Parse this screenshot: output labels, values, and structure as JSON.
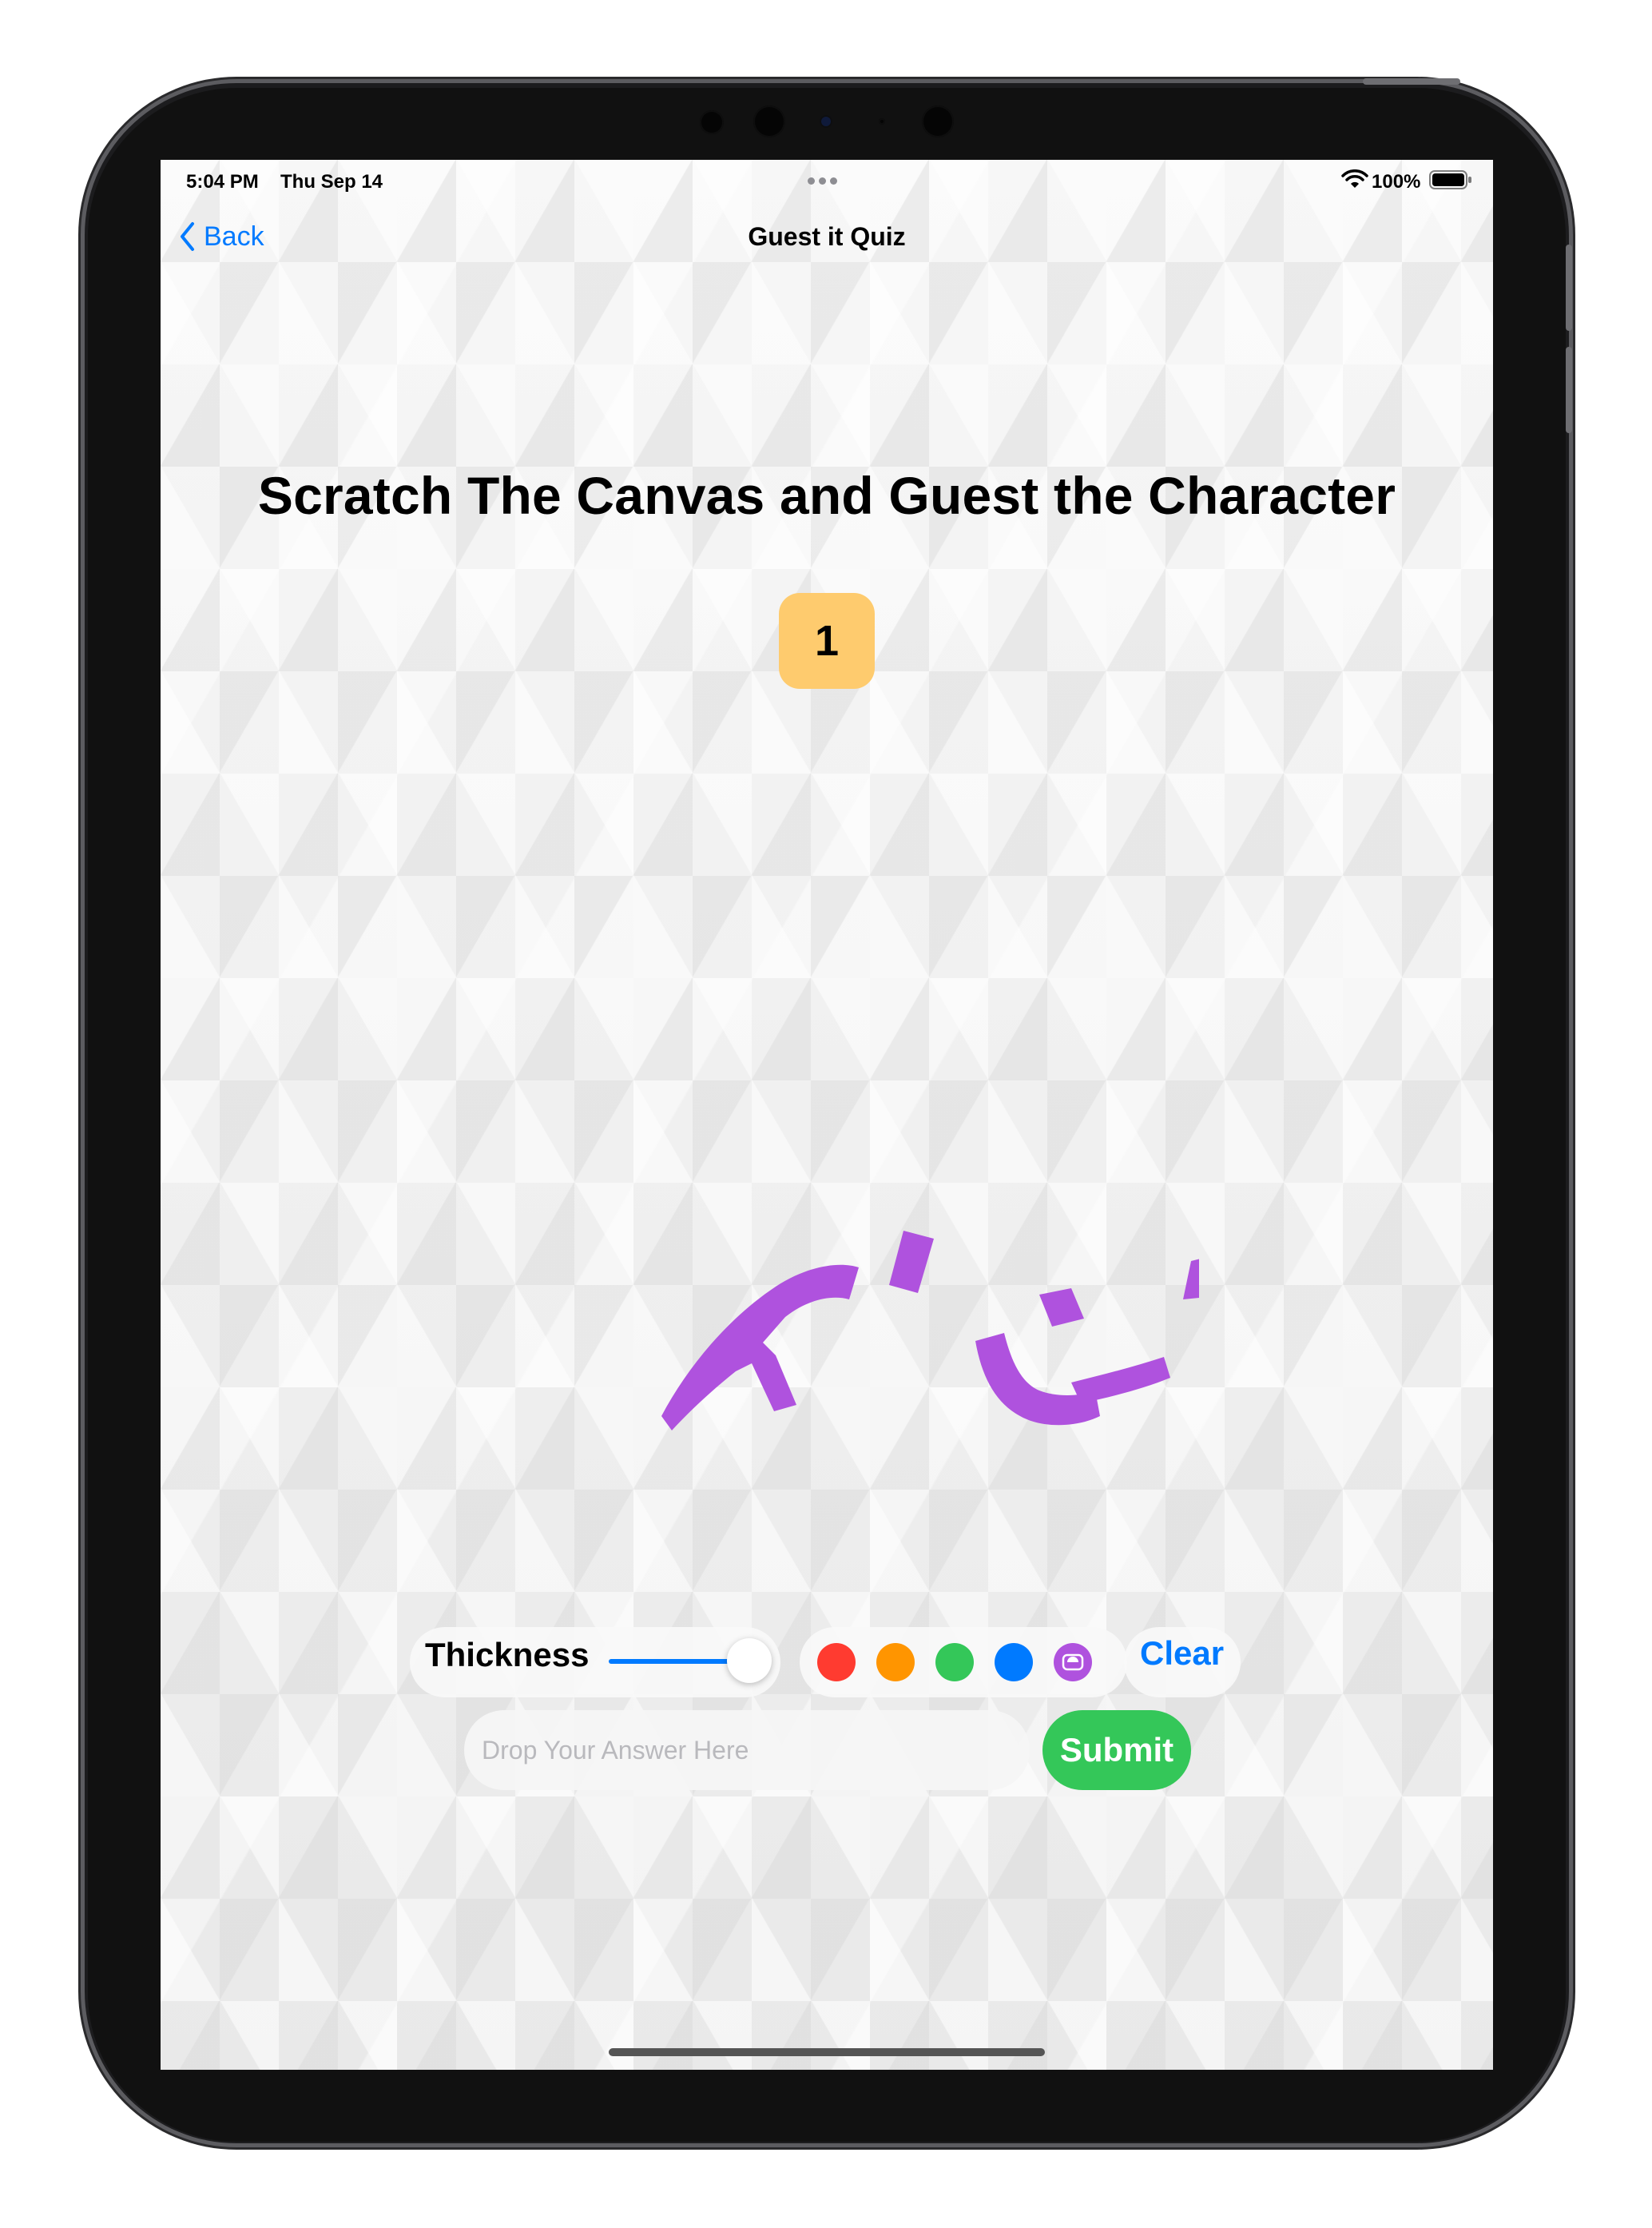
{
  "status_bar": {
    "time": "5:04 PM",
    "date": "Thu Sep 14",
    "battery": "100%"
  },
  "nav": {
    "back_label": "Back",
    "title": "Guest it Quiz"
  },
  "headline": "Scratch The Canvas and Guest the Character",
  "question_number": "1",
  "controls": {
    "thickness_label": "Thickness",
    "thickness_level": 0.9,
    "colors": [
      {
        "name": "red",
        "hex": "#ff3b30"
      },
      {
        "name": "orange",
        "hex": "#ff9500"
      },
      {
        "name": "green",
        "hex": "#34c759"
      },
      {
        "name": "blue",
        "hex": "#007aff"
      },
      {
        "name": "purple",
        "hex": "#af52de"
      }
    ],
    "selected_color": "purple",
    "clear_label": "Clear"
  },
  "answer": {
    "placeholder": "Drop Your Answer Here",
    "value": "",
    "submit_label": "Submit"
  },
  "theme": {
    "accent": "#007aff",
    "badge": "#fecb6e",
    "submit": "#34c759",
    "stroke": "#af52de"
  }
}
